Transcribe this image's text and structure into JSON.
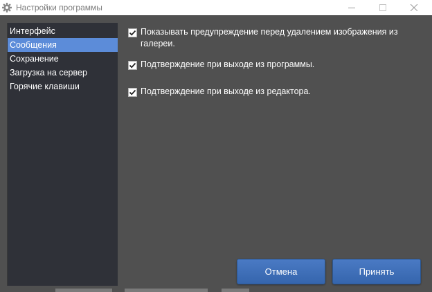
{
  "window": {
    "title": "Настройки программы",
    "icon": "gear-icon"
  },
  "sidebar": {
    "items": [
      {
        "label": "Интерфейс",
        "selected": false
      },
      {
        "label": "Сообщения",
        "selected": true
      },
      {
        "label": "Сохранение",
        "selected": false
      },
      {
        "label": "Загрузка на сервер",
        "selected": false
      },
      {
        "label": "Горячие клавиши",
        "selected": false
      }
    ]
  },
  "options": [
    {
      "label": "Показывать предупреждение перед удалением изображения из галереи.",
      "checked": true
    },
    {
      "label": "Подтверждение при выходе из программы.",
      "checked": true
    },
    {
      "label": "Подтверждение при выходе из редактора.",
      "checked": true
    }
  ],
  "buttons": {
    "cancel_label": "Отмена",
    "accept_label": "Принять"
  },
  "colors": {
    "background": "#505050",
    "sidebar": "#2f3138",
    "selection": "#5c8cd9",
    "button": "#3d6db8"
  }
}
